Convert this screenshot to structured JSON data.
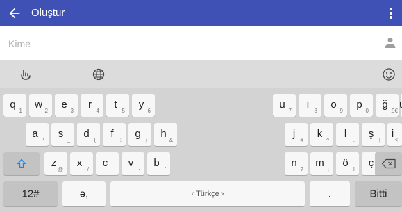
{
  "appbar": {
    "title": "Oluştur",
    "bg": "#3f51b5"
  },
  "compose": {
    "to_placeholder": "Kime"
  },
  "keyboard": {
    "rows": [
      [
        {
          "k": "q",
          "s": "1"
        },
        {
          "k": "w",
          "s": "2"
        },
        {
          "k": "e",
          "s": "3"
        },
        {
          "k": "r",
          "s": "4"
        },
        {
          "k": "t",
          "s": "5"
        },
        {
          "k": "y",
          "s": "6"
        },
        {
          "k": "u",
          "s": "7"
        },
        {
          "k": "ı",
          "s": "8"
        },
        {
          "k": "o",
          "s": "9"
        },
        {
          "k": "p",
          "s": "0"
        },
        {
          "k": "ğ",
          "s": "£"
        },
        {
          "k": "ü",
          "s": "€"
        }
      ],
      [
        {
          "k": "a",
          "s": "\\"
        },
        {
          "k": "s",
          "s": "_"
        },
        {
          "k": "d",
          "s": "{"
        },
        {
          "k": "f",
          "s": ":"
        },
        {
          "k": "g",
          "s": ")"
        },
        {
          "k": "h",
          "s": "&"
        },
        {
          "k": "j",
          "s": "#"
        },
        {
          "k": "k",
          "s": "^"
        },
        {
          "k": "l",
          "s": "."
        },
        {
          "k": "ş",
          "s": "|"
        },
        {
          "k": "i",
          "s": "<"
        }
      ],
      [
        {
          "k": "z",
          "s": "@"
        },
        {
          "k": "x",
          "s": "/"
        },
        {
          "k": "c",
          "s": ""
        },
        {
          "k": "v",
          "s": "·"
        },
        {
          "k": "b",
          "s": "'"
        },
        {
          "k": "n",
          "s": "?"
        },
        {
          "k": "m",
          "s": ";"
        },
        {
          "k": "ö",
          "s": "!"
        },
        {
          "k": "ç",
          "s": "÷"
        }
      ]
    ],
    "num_label": "12#",
    "comma_label": "ə,",
    "space_label": "‹ Türkçe ›",
    "period_label": ".",
    "done_label": "Bitti"
  }
}
